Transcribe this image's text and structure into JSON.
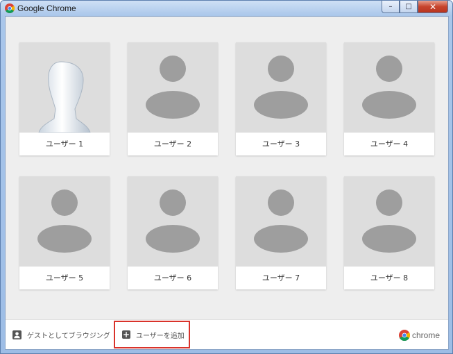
{
  "window": {
    "title": "Google Chrome",
    "controls": {
      "minimize": "–",
      "maximize": "□",
      "close": "✕"
    }
  },
  "profiles": [
    {
      "name": "ユーザー 1",
      "avatar": "silhouette-mannequin"
    },
    {
      "name": "ユーザー 2",
      "avatar": "generic-person"
    },
    {
      "name": "ユーザー 3",
      "avatar": "generic-person"
    },
    {
      "name": "ユーザー 4",
      "avatar": "generic-person"
    },
    {
      "name": "ユーザー 5",
      "avatar": "generic-person"
    },
    {
      "name": "ユーザー 6",
      "avatar": "generic-person"
    },
    {
      "name": "ユーザー 7",
      "avatar": "generic-person"
    },
    {
      "name": "ユーザー 8",
      "avatar": "generic-person"
    }
  ],
  "footer": {
    "guest_label": "ゲストとしてブラウジング",
    "add_user_label": "ユーザーを追加",
    "brand_text": "chrome"
  },
  "colors": {
    "highlight_border": "#d9322a",
    "avatar_bg": "#dddddd",
    "avatar_figure": "#9e9e9e"
  }
}
